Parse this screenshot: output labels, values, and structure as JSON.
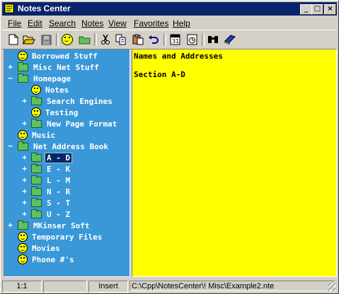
{
  "window": {
    "title": "Notes Center",
    "controls": {
      "minimize": "_",
      "maximize": "□",
      "close": "×"
    }
  },
  "menu": [
    "File",
    "Edit",
    "Search",
    "Notes",
    "View",
    "Favorites",
    "Help"
  ],
  "tree": {
    "items": [
      {
        "label": "Borrowed Stuff",
        "icon": "smiley-icon",
        "expander": ""
      },
      {
        "label": "Misc Net Stuff",
        "icon": "folder-icon",
        "expander": "+"
      },
      {
        "label": "Homepage",
        "icon": "folder-open-icon",
        "expander": "−"
      },
      {
        "label": "Notes",
        "icon": "smiley-icon",
        "expander": ""
      },
      {
        "label": "Search Engines",
        "icon": "folder-icon",
        "expander": "+"
      },
      {
        "label": "Testing",
        "icon": "smiley-icon",
        "expander": ""
      },
      {
        "label": "New Page Format",
        "icon": "folder-icon",
        "expander": "+"
      },
      {
        "label": "Music",
        "icon": "smiley-icon",
        "expander": ""
      },
      {
        "label": "Net Address Book",
        "icon": "folder-open-icon",
        "expander": "−"
      },
      {
        "label": "A - D",
        "icon": "folder-icon",
        "expander": "+",
        "selected": true
      },
      {
        "label": "E - K",
        "icon": "folder-icon",
        "expander": "+"
      },
      {
        "label": "L - M",
        "icon": "folder-icon",
        "expander": "+"
      },
      {
        "label": "N - R",
        "icon": "folder-icon",
        "expander": "+"
      },
      {
        "label": "S - T",
        "icon": "folder-icon",
        "expander": "+"
      },
      {
        "label": "U - Z",
        "icon": "folder-icon",
        "expander": "+"
      },
      {
        "label": "MKinser Soft",
        "icon": "folder-icon",
        "expander": "+"
      },
      {
        "label": "Temporary Files",
        "icon": "smiley-icon",
        "expander": ""
      },
      {
        "label": "Movies",
        "icon": "smiley-icon",
        "expander": ""
      },
      {
        "label": "Phone #'s",
        "icon": "smiley-icon",
        "expander": ""
      }
    ]
  },
  "note": {
    "lines": [
      "Names and Addresses",
      "",
      "Section A-D"
    ]
  },
  "status": {
    "position": "1:1",
    "blank": "",
    "mode": "Insert",
    "path": "C:\\Cpp\\NotesCenter\\! Misc\\Example2.nte"
  },
  "colors": {
    "tree_bg": "#3a98d8",
    "note_bg": "#ffff00",
    "title_bar": "#0a246a"
  }
}
